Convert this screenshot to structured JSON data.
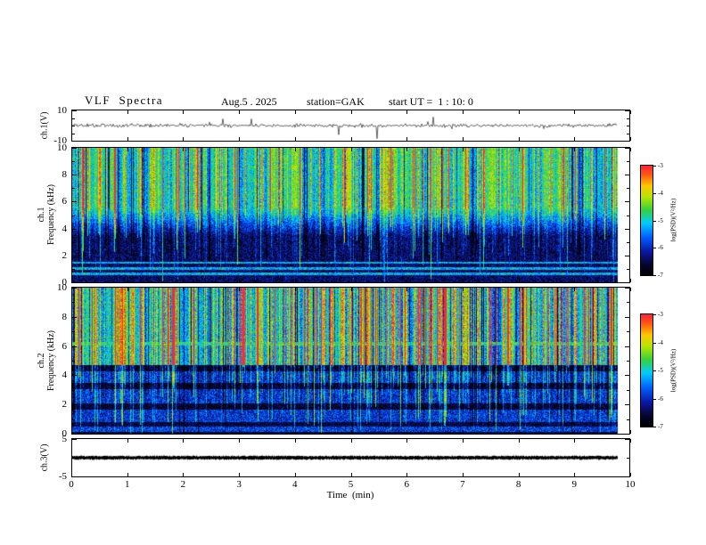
{
  "header": {
    "title": "VLF  Spectra",
    "date": "Aug.5 . 2025",
    "station": "station=GAK",
    "start_ut": "start UT =  1 : 10: 0"
  },
  "xaxis": {
    "label": "Time  (min)",
    "ticks": [
      "0",
      "1",
      "2",
      "3",
      "4",
      "5",
      "6",
      "7",
      "8",
      "9",
      "10"
    ],
    "range": [
      0,
      10
    ]
  },
  "chart_data": [
    {
      "type": "line",
      "name": "ch1-waveform",
      "ylabel": "ch.1(V)",
      "ylim": [
        -10,
        10
      ],
      "yticks": [
        10,
        -10
      ],
      "x_range": [
        0,
        9.8
      ],
      "description": "broadband noise waveform centred on 0 V, amplitude mostly within ±2 V with sparse impulsive spikes reaching about ±8 V"
    },
    {
      "type": "heatmap",
      "name": "ch1-spectrogram",
      "ylabel_channel": "ch.1",
      "ylabel": "Frequency (kHz)",
      "ylim": [
        0,
        10
      ],
      "yticks": [
        0,
        2,
        4,
        6,
        8,
        10
      ],
      "x_range": [
        0,
        9.8
      ],
      "colorbar": {
        "label": "log(PSD)(V²/Hz)",
        "ticks": [
          -3,
          -4,
          -5,
          -6,
          -7
        ],
        "range": [
          -7,
          -3
        ]
      },
      "description": "diffuse green/cyan power above ~5.5 kHz, dark blue/black below, dense vertical broadband streaks (yellow/red at top, cyan below) of varying depth, narrow cyan horizontal lines near 0.6–1.5 kHz"
    },
    {
      "type": "heatmap",
      "name": "ch2-spectrogram",
      "ylabel_channel": "ch.2",
      "ylabel": "Frequency (kHz)",
      "ylim": [
        0,
        10
      ],
      "yticks": [
        0,
        2,
        4,
        6,
        8,
        10
      ],
      "x_range": [
        0,
        9.8
      ],
      "colorbar": {
        "label": "log(PSD)(V²/Hz)",
        "ticks": [
          -3,
          -4,
          -5,
          -6,
          -7
        ],
        "range": [
          -7,
          -3
        ]
      },
      "description": "intense red/orange vertical streaks over a green background above ~4.7 kHz, steady green line near 6.2 kHz, horizontal dark/blue banding with cyan dashes below 4.7 kHz"
    },
    {
      "type": "line",
      "name": "ch3-waveform",
      "ylabel": "ch.3(V)",
      "ylim": [
        -5,
        5
      ],
      "yticks": [
        5,
        -5
      ],
      "x_range": [
        0,
        9.8
      ],
      "value": 0,
      "description": "flat dense black trace at 0 V"
    }
  ]
}
